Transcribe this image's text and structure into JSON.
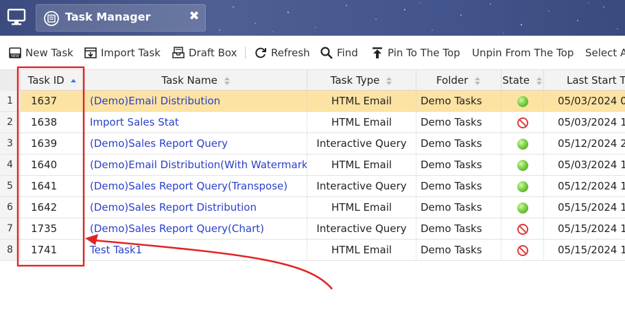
{
  "window": {
    "tab_title": "Task Manager",
    "tab_close": "✖"
  },
  "toolbar": {
    "new_task": "New Task",
    "import_task": "Import Task",
    "draft_box": "Draft Box",
    "refresh": "Refresh",
    "find": "Find",
    "pin_to_top": "Pin To The Top",
    "unpin_from_top": "Unpin From The Top",
    "select_all": "Select A"
  },
  "table": {
    "columns": {
      "task_id": "Task ID",
      "task_name": "Task Name",
      "task_type": "Task Type",
      "folder": "Folder",
      "state": "State",
      "last_start": "Last Start Ti"
    },
    "rows": [
      {
        "num": "1",
        "id": "1637",
        "name": "(Demo)Email Distribution",
        "type": "HTML Email",
        "folder": "Demo Tasks",
        "state": "enabled",
        "last_start": "05/03/2024 0"
      },
      {
        "num": "2",
        "id": "1638",
        "name": "Import Sales Stat",
        "type": "HTML Email",
        "folder": "Demo Tasks",
        "state": "disabled",
        "last_start": "05/03/2024 1"
      },
      {
        "num": "3",
        "id": "1639",
        "name": "(Demo)Sales Report Query",
        "type": "Interactive Query",
        "folder": "Demo Tasks",
        "state": "enabled",
        "last_start": "05/12/2024 2"
      },
      {
        "num": "4",
        "id": "1640",
        "name": "(Demo)Email Distribution(With Watermark)",
        "type": "HTML Email",
        "folder": "Demo Tasks",
        "state": "enabled",
        "last_start": "05/03/2024 1"
      },
      {
        "num": "5",
        "id": "1641",
        "name": "(Demo)Sales Report Query(Transpose)",
        "type": "Interactive Query",
        "folder": "Demo Tasks",
        "state": "enabled",
        "last_start": "05/12/2024 1"
      },
      {
        "num": "6",
        "id": "1642",
        "name": "(Demo)Sales Report Distribution",
        "type": "HTML Email",
        "folder": "Demo Tasks",
        "state": "enabled",
        "last_start": "05/15/2024 1"
      },
      {
        "num": "7",
        "id": "1735",
        "name": "(Demo)Sales Report Query(Chart)",
        "type": "Interactive Query",
        "folder": "Demo Tasks",
        "state": "disabled",
        "last_start": "05/15/2024 1"
      },
      {
        "num": "8",
        "id": "1741",
        "name": "Test Task1",
        "type": "HTML Email",
        "folder": "Demo Tasks",
        "state": "disabled",
        "last_start": "05/15/2024 1"
      }
    ],
    "selected_row": 0
  },
  "colors": {
    "selected_row": "#fde3a3",
    "link": "#2a3fc9",
    "annotation": "#e02424"
  },
  "icons": [
    "monitor-icon",
    "task-manager-icon",
    "close-icon",
    "new-task-icon",
    "import-task-icon",
    "draft-box-icon",
    "refresh-icon",
    "find-icon",
    "pin-top-icon",
    "sort-asc-icon",
    "sort-both-icon",
    "state-enabled-icon",
    "state-disabled-icon"
  ]
}
